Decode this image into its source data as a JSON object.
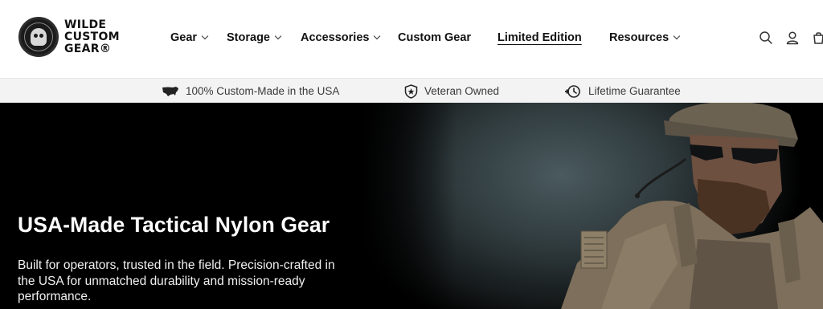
{
  "brand": {
    "name_lines": [
      "WILDE",
      "CUSTOM",
      "GEAR®"
    ],
    "logo_icon": "skull-badge-icon"
  },
  "nav": {
    "items": [
      {
        "label": "Gear",
        "has_dropdown": true
      },
      {
        "label": "Storage",
        "has_dropdown": true
      },
      {
        "label": "Accessories",
        "has_dropdown": true
      },
      {
        "label": "Custom Gear",
        "has_dropdown": false
      },
      {
        "label": "Limited Edition",
        "has_dropdown": false,
        "active": true
      },
      {
        "label": "Resources",
        "has_dropdown": true
      }
    ],
    "icons": [
      "search-icon",
      "account-icon",
      "cart-icon"
    ]
  },
  "usp_bar": {
    "items": [
      {
        "icon": "usa-map-icon",
        "text": "100% Custom-Made in the USA"
      },
      {
        "icon": "star-shield-icon",
        "text": "Veteran Owned"
      },
      {
        "icon": "lifetime-clock-icon",
        "text": "Lifetime Guarantee"
      }
    ]
  },
  "hero": {
    "title": "USA-Made Tactical Nylon Gear",
    "subtitle": "Built for operators, trusted in the field. Precision-crafted in the USA for unmatched durability and mission-ready performance.",
    "image": "soldier-in-tactical-gear-photo"
  },
  "colors": {
    "header_bg": "#ffffff",
    "usp_bg": "#f3f3f3",
    "hero_bg": "#000000",
    "text": "#121212"
  }
}
